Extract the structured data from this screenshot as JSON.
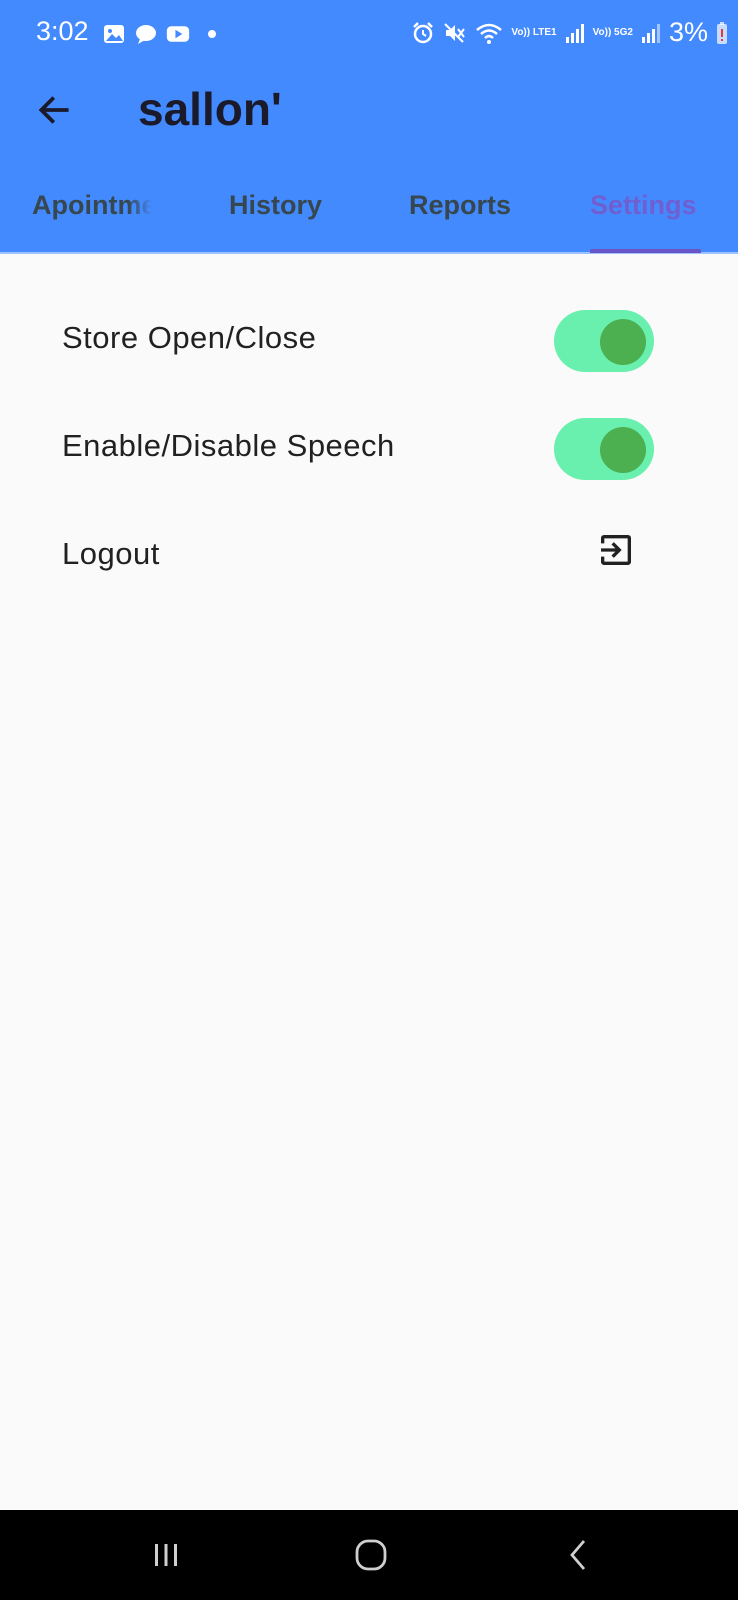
{
  "status_bar": {
    "time": "3:02",
    "battery": "3%",
    "network_labels": [
      "Vo)) LTE1",
      "Vo)) 5G2"
    ],
    "left_icons": [
      "gallery-icon",
      "chat-icon",
      "youtube-icon"
    ],
    "right_icons": [
      "alarm-icon",
      "mute-icon",
      "wifi-icon",
      "signal-icon",
      "signal-icon",
      "battery-icon"
    ]
  },
  "toolbar": {
    "title": "sallon'",
    "back_icon": "arrow-back-icon"
  },
  "tabs": [
    {
      "label": "Apointments",
      "selected": false
    },
    {
      "label": "History",
      "selected": false
    },
    {
      "label": "Reports",
      "selected": false
    },
    {
      "label": "Settings",
      "selected": true
    }
  ],
  "settings": {
    "store_label": "Store Open/Close",
    "store_on": true,
    "speech_label": "Enable/Disable Speech",
    "speech_on": true,
    "logout_label": "Logout",
    "logout_icon": "logout-icon"
  },
  "colors": {
    "header": "#448aff",
    "tab_selected": "#6f5fd0",
    "switch_track": "#69f0ae",
    "switch_thumb": "#4caf50",
    "background": "#fafafa"
  },
  "nav": [
    "recents-icon",
    "home-icon",
    "back-icon"
  ]
}
